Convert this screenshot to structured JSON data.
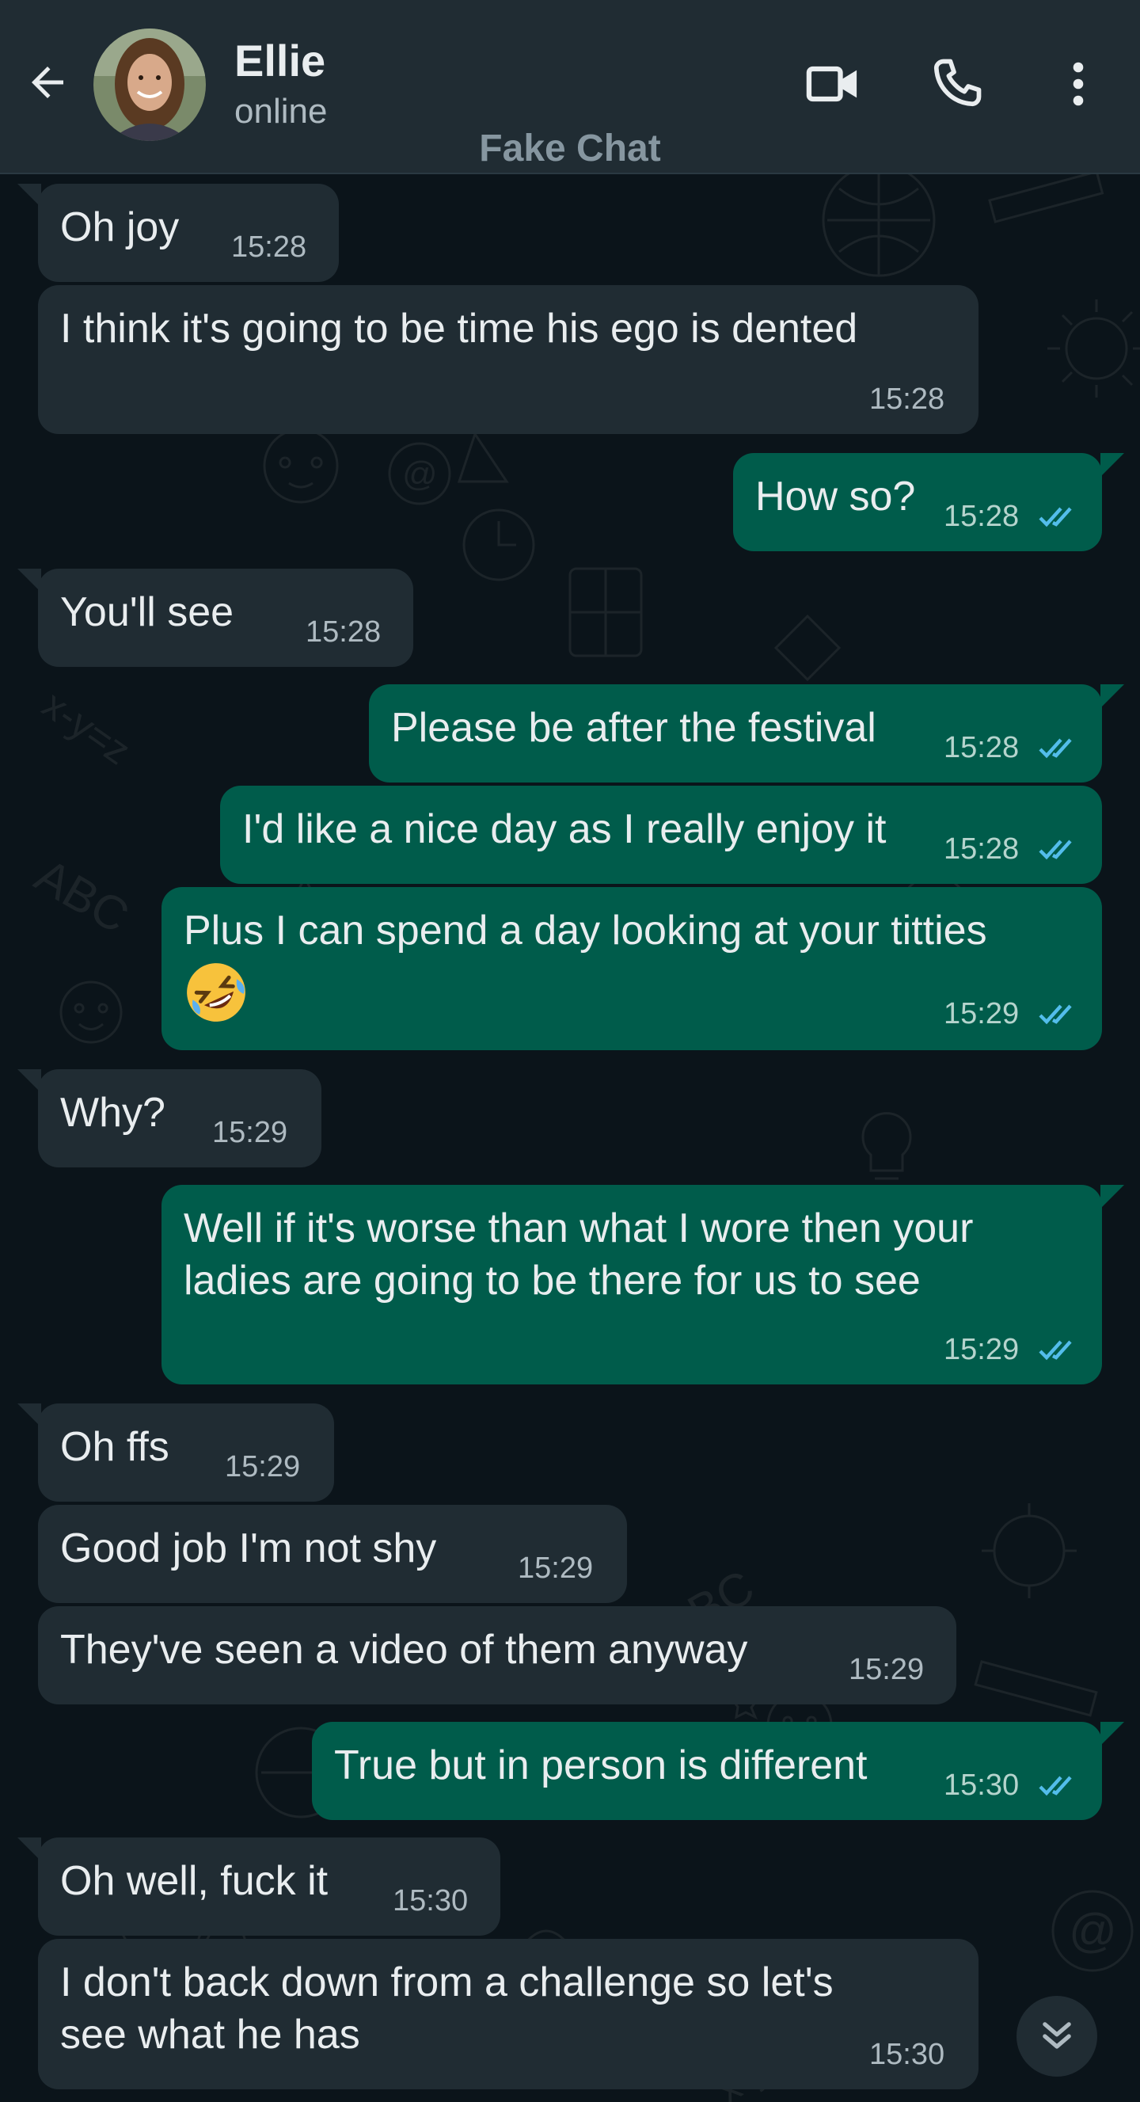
{
  "header": {
    "contact_name": "Ellie",
    "status": "online",
    "watermark": "Fake Chat",
    "icons": {
      "back": "arrow-left-icon",
      "video": "video-camera-icon",
      "call": "phone-icon",
      "menu": "more-vertical-icon"
    }
  },
  "colors": {
    "header_bg": "#202c33",
    "chat_bg": "#0b141a",
    "incoming_bubble": "#202c33",
    "outgoing_bubble": "#005c4b",
    "read_ticks": "#53bdeb"
  },
  "messages": [
    {
      "direction": "in",
      "text": "Oh joy",
      "time": "15:28"
    },
    {
      "direction": "in",
      "text": "I think it's going to be time his ego is dented",
      "time": "15:28"
    },
    {
      "direction": "out",
      "text": "How so?",
      "time": "15:28",
      "status": "read"
    },
    {
      "direction": "in",
      "text": "You'll see",
      "time": "15:28"
    },
    {
      "direction": "out",
      "text": "Please be after the festival",
      "time": "15:28",
      "status": "read"
    },
    {
      "direction": "out",
      "text": "I'd like a nice day as I really enjoy it",
      "time": "15:28",
      "status": "read"
    },
    {
      "direction": "out",
      "text": "Plus I can spend a day looking at your titties",
      "emoji": "rolling-on-floor-laughing-emoji",
      "time": "15:29",
      "status": "read"
    },
    {
      "direction": "in",
      "text": "Why?",
      "time": "15:29"
    },
    {
      "direction": "out",
      "text": "Well if it's worse than what I wore then your\nladies are going to be there for us to see",
      "time": "15:29",
      "status": "read"
    },
    {
      "direction": "in",
      "text": "Oh ffs",
      "time": "15:29"
    },
    {
      "direction": "in",
      "text": "Good job I'm not shy",
      "time": "15:29"
    },
    {
      "direction": "in",
      "text": "They've seen a video of them anyway",
      "time": "15:29"
    },
    {
      "direction": "out",
      "text": "True but in person is different",
      "time": "15:30",
      "status": "read"
    },
    {
      "direction": "in",
      "text": "Oh well, fuck it",
      "time": "15:30"
    },
    {
      "direction": "in",
      "text": "I don't back down from a challenge so let's\nsee what he has",
      "time": "15:30"
    }
  ],
  "scroll_button": {
    "icon": "double-chevron-down-icon"
  }
}
